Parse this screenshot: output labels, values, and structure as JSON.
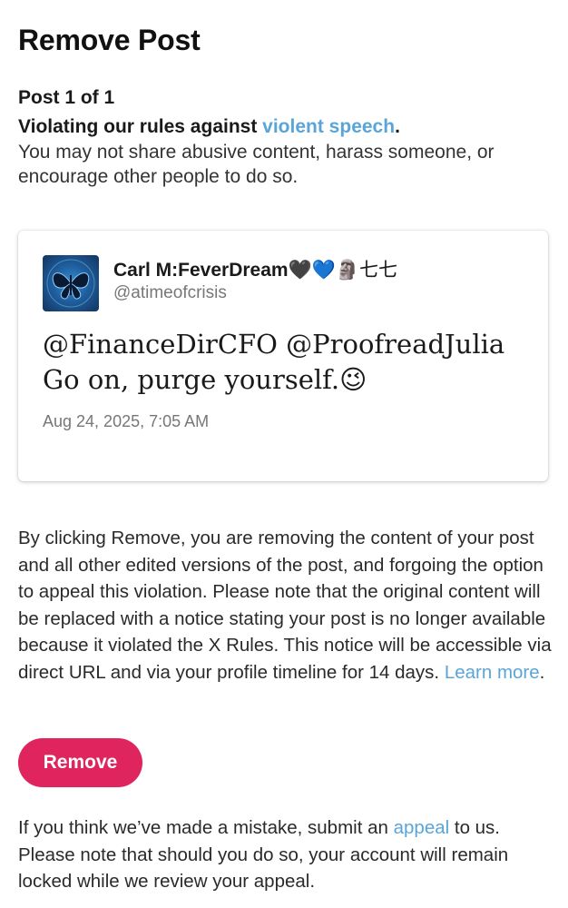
{
  "header": {
    "title": "Remove Post"
  },
  "violation": {
    "post_count": "Post 1 of 1",
    "rule_prefix": "Violating our rules against ",
    "rule_link": "violent speech",
    "rule_suffix": ".",
    "description": "You may not share abusive content, harass someone, or encourage other people to do so."
  },
  "tweet": {
    "display_name": "Carl M:FeverDream",
    "display_name_emoji": "🖤💙🗿七七",
    "handle": "@atimeofcrisis",
    "text_line1": "@FinanceDirCFO @ProofreadJulia",
    "text_line2": "Go on, purge yourself.",
    "text_emoji": "😉",
    "timestamp": "Aug 24, 2025, 7:05 AM"
  },
  "notice": {
    "text": "By clicking Remove, you are removing the content of your post and all other edited versions of the post, and forgoing the option to appeal this violation. Please note that the original content will be replaced with a notice stating your post is no longer available because it violated the X Rules. This notice will be accessible via direct URL and via your profile timeline for 14 days. ",
    "learn_more": "Learn more",
    "end": "."
  },
  "actions": {
    "remove_label": "Remove"
  },
  "appeal": {
    "prefix": "If you think we’ve made a mistake, submit an ",
    "link": "appeal",
    "suffix": " to us. Please note that should you do so, your account will remain locked while we review your appeal."
  },
  "colors": {
    "accent_link": "#5aa5d8",
    "remove_button": "#e0245e",
    "avatar_blue": "#1f5f9f"
  },
  "icons": {
    "avatar": "butterfly-avatar"
  }
}
